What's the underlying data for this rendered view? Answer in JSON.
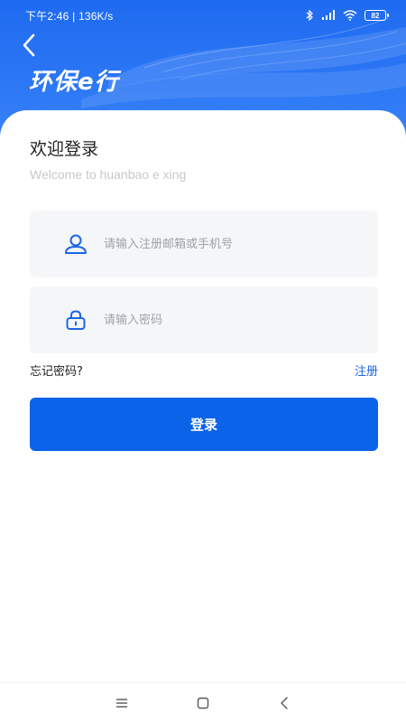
{
  "status_bar": {
    "left_text": "下午2:46 | 136K/s",
    "battery": "82",
    "icons": [
      "bluetooth-icon",
      "signal-icon",
      "wifi-icon",
      "battery-icon"
    ]
  },
  "header": {
    "logo_text": "环保e行",
    "back_icon": "chevron-left-icon",
    "colors": {
      "primary": "#1f6bf0",
      "accent": "#0a63e8"
    }
  },
  "welcome": {
    "title": "欢迎登录",
    "subtitle": "Welcome to huanbao e xing"
  },
  "form": {
    "account": {
      "placeholder": "请输入注册邮箱或手机号",
      "value": "",
      "icon": "user-icon"
    },
    "password": {
      "placeholder": "请输入密码",
      "value": "",
      "icon": "lock-icon"
    },
    "forgot_label": "忘记密码?",
    "register_label": "注册",
    "login_label": "登录"
  },
  "nav_bar": {
    "icons": [
      "menu-icon",
      "home-icon",
      "back-icon"
    ]
  }
}
